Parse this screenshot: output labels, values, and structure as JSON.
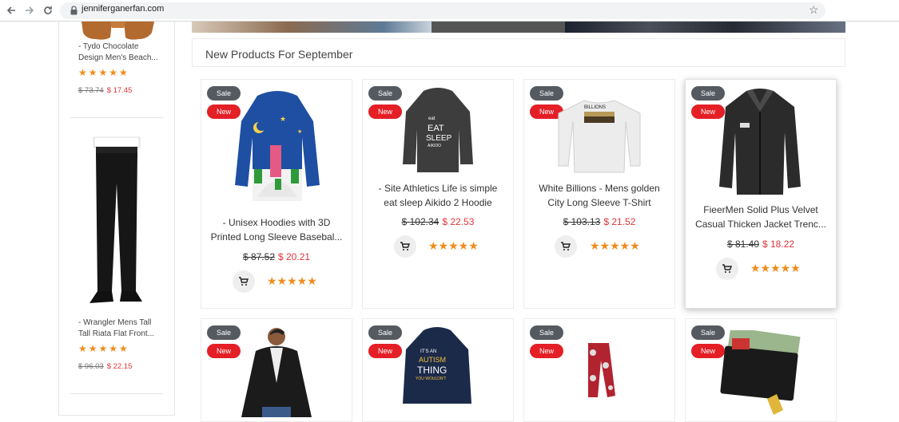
{
  "browser": {
    "url": "jenniferganerfan.com",
    "back_icon": "arrow-left-icon",
    "forward_icon": "arrow-right-icon",
    "reload_icon": "reload-icon",
    "bookmark_icon": "star-outline-icon"
  },
  "sidebar": {
    "items": [
      {
        "name_line1": "- Tydo Chocolate",
        "name_line2": "Design Men's Beach...",
        "stars": "★★★★★",
        "old_price": "$ 73.74",
        "new_price": "$ 17.45"
      },
      {
        "name_line1": "- Wrangler Mens Tall",
        "name_line2": "Tall Riata Flat Front...",
        "stars": "★★★★★",
        "old_price": "$ 96.03",
        "new_price": "$ 22.15"
      }
    ]
  },
  "section": {
    "title": "New Products For September"
  },
  "badges": {
    "sale": "Sale",
    "new": "New"
  },
  "products": [
    {
      "name_line1": "- Unisex Hoodies with 3D",
      "name_line2": "Printed Long Sleeve Basebal...",
      "old_price": "$ 87.52",
      "new_price": "$ 20.21",
      "stars": "★★★★★"
    },
    {
      "name_line1": "- Site Athletics Life is simple",
      "name_line2": "eat sleep Aikido 2 Hoodie",
      "old_price": "$ 102.34",
      "new_price": "$ 22.53",
      "stars": "★★★★★"
    },
    {
      "name_line1": "White Billions - Mens golden",
      "name_line2": "City Long Sleeve T-Shirt",
      "old_price": "$ 103.13",
      "new_price": "$ 21.52",
      "stars": "★★★★★"
    },
    {
      "name_line1": "FieerMen Solid Plus Velvet",
      "name_line2": "Casual Thicken Jacket Trenc...",
      "old_price": "$ 81.40",
      "new_price": "$ 18.22",
      "stars": "★★★★★"
    }
  ],
  "colors": {
    "accent_red": "#e41f26",
    "sale_gray": "#555a60",
    "star_orange": "#f08c1c",
    "price_red": "#e0343a"
  }
}
